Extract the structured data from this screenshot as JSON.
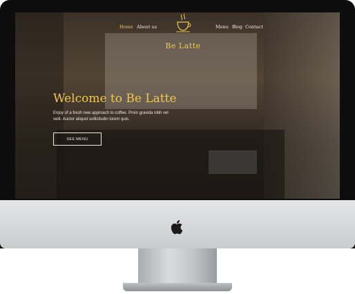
{
  "nav": {
    "items": [
      {
        "label": "Home",
        "active": true
      },
      {
        "label": "About us",
        "active": false
      },
      {
        "label": "Menu",
        "active": false
      },
      {
        "label": "Blog",
        "active": false
      },
      {
        "label": "Contact",
        "active": false
      }
    ]
  },
  "brand": {
    "name": "Be Latte",
    "icon": "coffee-cup-icon"
  },
  "hero": {
    "title": "Welcome to Be Latte",
    "text": "Enjoy of a fresh new approach to coffee. Proin gravida nibh vel velit. Auctor aliquet sollicitudin lorem quis.",
    "button_label": "SEE MENU"
  },
  "device": {
    "logo_icon": "apple-logo-icon"
  },
  "colors": {
    "accent": "#f3c84b",
    "text_light": "#f1ece2"
  }
}
